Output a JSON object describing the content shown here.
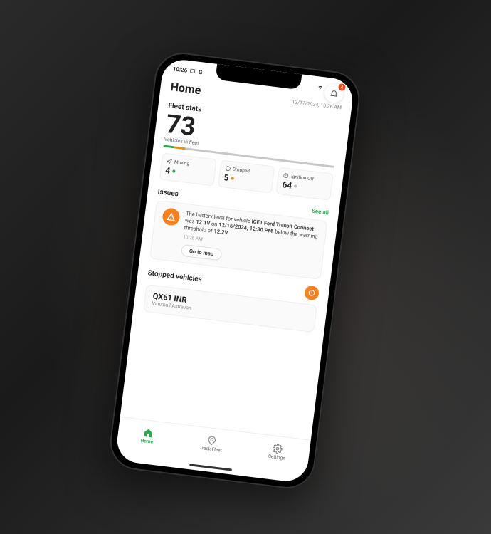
{
  "status_bar": {
    "time": "10:26",
    "icons_left": "G"
  },
  "header": {
    "title": "Home",
    "datetime": "12/17/2024, 10:26 AM",
    "bell_badge": "4"
  },
  "fleet_stats": {
    "label": "Fleet stats",
    "count": "73",
    "sublabel": "Vehicles in fleet",
    "cards": {
      "moving": {
        "label": "Moving",
        "value": "4"
      },
      "stopped": {
        "label": "Stopped",
        "value": "5"
      },
      "ignition_off": {
        "label": "Ignition Off",
        "value": "64"
      }
    }
  },
  "issues": {
    "label": "Issues",
    "see_all": "See all",
    "card": {
      "prefix": "The battery level for vehicle ",
      "vehicle": "ICE1 Ford Transit Connect",
      "mid1": " was ",
      "voltage": "12.1V",
      "mid2": " on ",
      "timestamp": "12/16/2024, 12:30 PM",
      "mid3": ", below the warning threshold of ",
      "threshold": "12.2V",
      "time_ago": "10:26 AM",
      "button": "Go to map"
    }
  },
  "stopped": {
    "label": "Stopped vehicles",
    "vehicle": {
      "name": "QX61 INR",
      "sub": "Vauxhall Astravan"
    }
  },
  "nav": {
    "home": "Home",
    "track": "Track Fleet",
    "settings": "Settings"
  }
}
